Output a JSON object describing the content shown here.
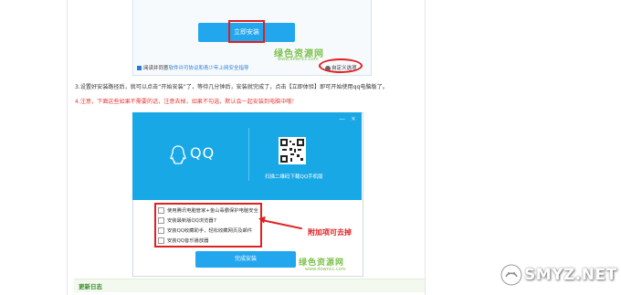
{
  "top_shot": {
    "install_button": "立即安装",
    "watermark": "绿色资源网",
    "watermark_sub": "www.downcc.com",
    "agree_prefix": "阅读并同意",
    "agree_links": "软件许可协议和青少年上网安全指导",
    "custom_option": "自定义选项"
  },
  "step3": "3.设置好安装路径后，就可以点击“开始安装”了，等待几分钟后，安装就完成了，点击【立即体验】即可开始使用qq电脑版了。",
  "step4": "4.注意，下面这些如果不需要的话，注意去掉，如果不勾选，默认会一起安装到电脑中哦！",
  "qq_installer": {
    "win_controls": [
      "—",
      "×"
    ],
    "logo_text": "QQ",
    "qr_caption": "扫描二维码下载QQ手机版",
    "options": [
      "使用腾讯电脑管家+金山毒霸保护电脑安全",
      "安装最新版QQ浏览器7",
      "安装QQ收藏助手，轻松收藏网页及邮件",
      "安装QQ音乐播放器"
    ],
    "annotation": "附加项可去掉",
    "finish_button": "完成安装",
    "watermark": "绿色资源网",
    "watermark_sub": "www.downcc.com"
  },
  "update_log": "更新日志",
  "brand": "SMYZ.NET"
}
